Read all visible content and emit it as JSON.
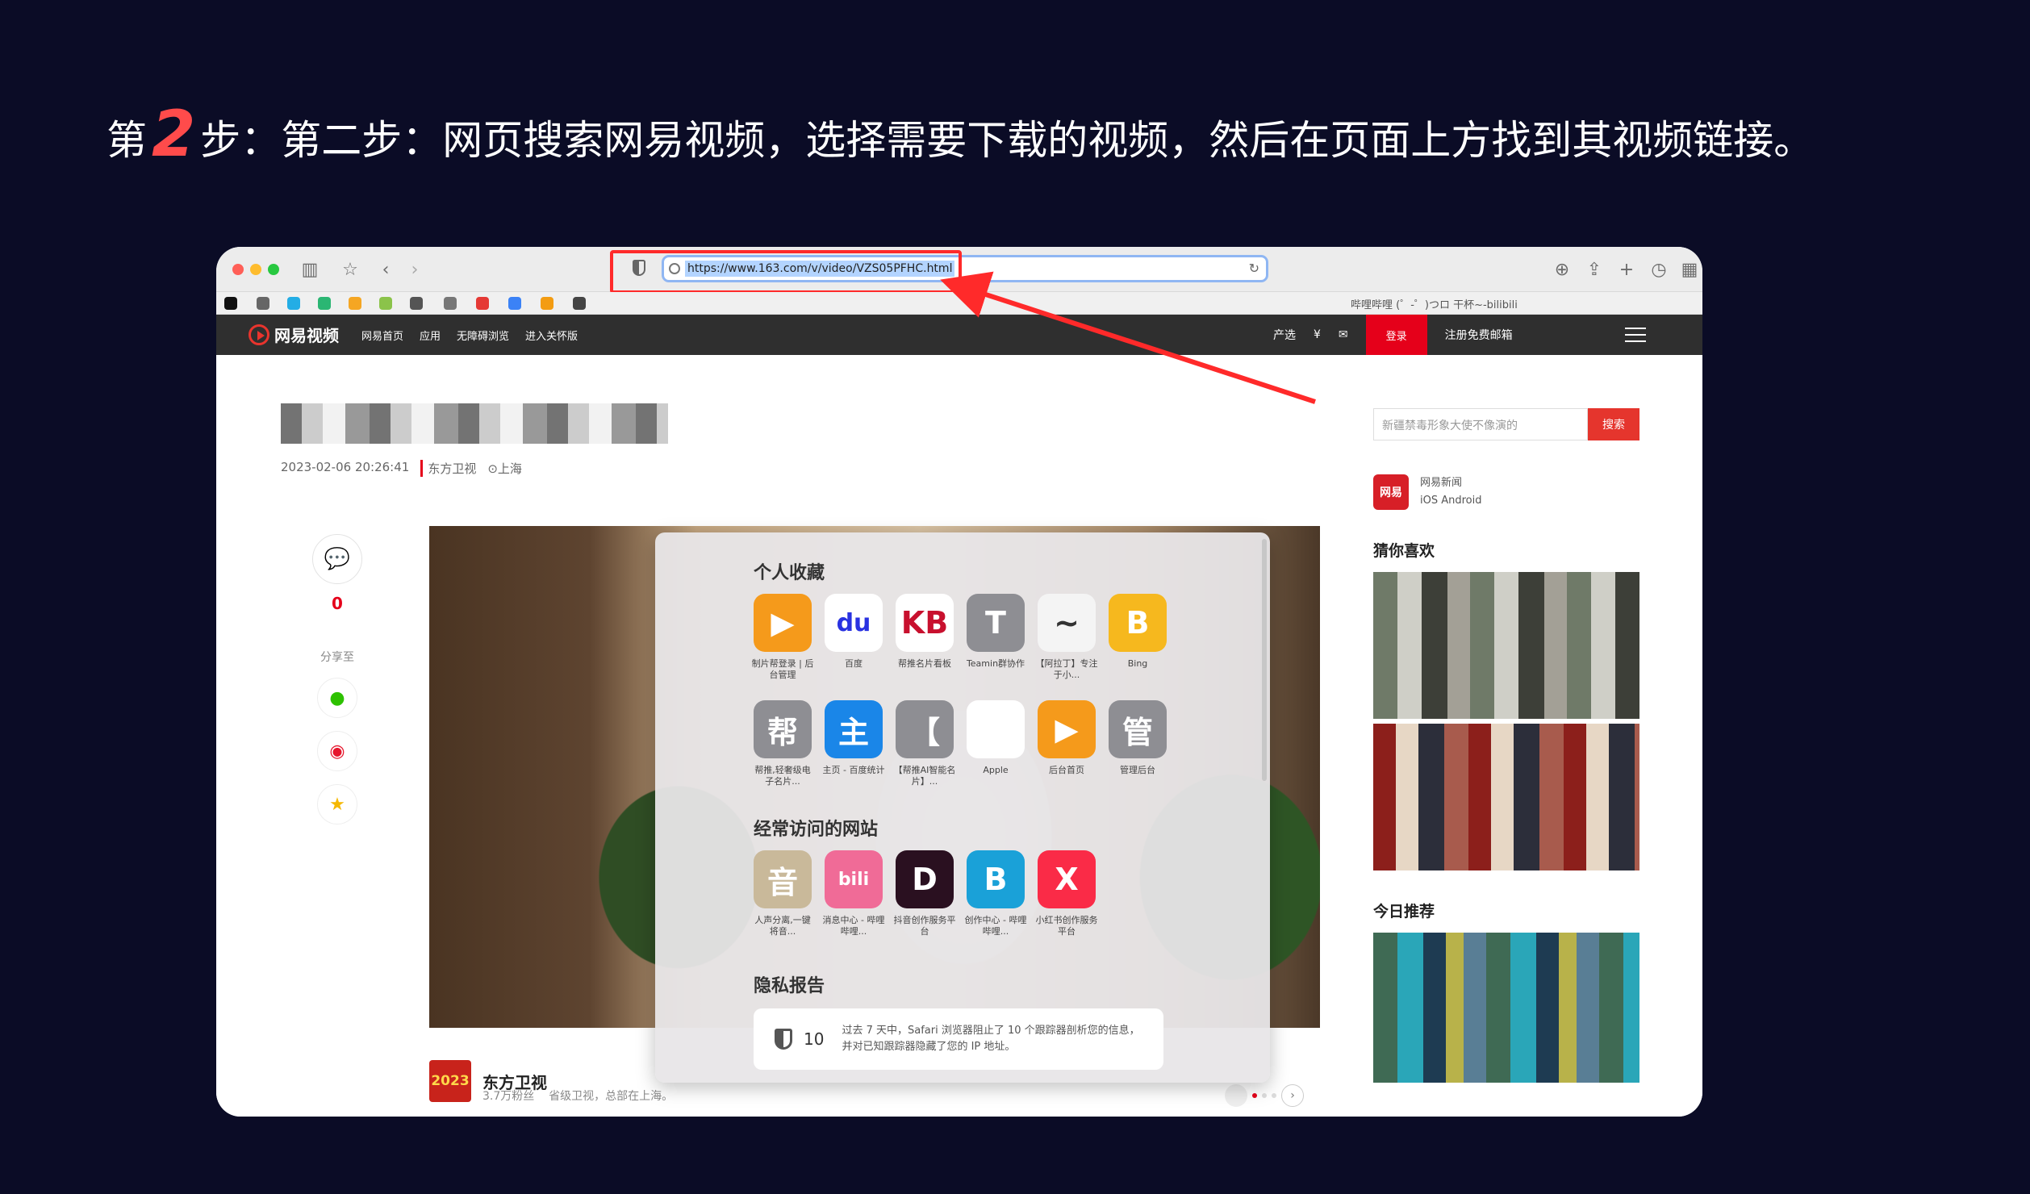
{
  "heading": {
    "prefix": "第",
    "number": "2",
    "text": "步：第二步：网页搜索网易视频，选择需要下载的视频，然后在页面上方找到其视频链接。"
  },
  "browser": {
    "url": "https://www.163.com/v/video/VZS05PFHC.html",
    "tab_title": "哔哩哔哩 (゜-゜)つロ 干杯~-bilibili",
    "icons": [
      "sidebar-icon",
      "bookmark-star-icon",
      "back-icon",
      "forward-icon",
      "shield-icon",
      "reload-icon",
      "download-icon",
      "share-icon",
      "new-tab-icon",
      "history-icon",
      "tab-overview-icon"
    ]
  },
  "site_nav": {
    "logo": "网易视频",
    "links": [
      "网易首页",
      "应用",
      "无障碍浏览",
      "进入关怀版"
    ],
    "right": [
      "产选",
      "¥",
      "✉"
    ],
    "login": "登录",
    "register": "注册免费邮箱"
  },
  "article": {
    "date": "2023-02-06 20:26:41",
    "source": "东方卫视",
    "location": "上海",
    "comment_count": "0",
    "share_label": "分享至",
    "channel_name": "东方卫视",
    "channel_logo": "2023",
    "channel_fans": "3.7万粉丝",
    "channel_desc": "省级卫视，总部在上海。"
  },
  "sidebar": {
    "search_placeholder": "新疆禁毒形象大使不像演的",
    "search_button": "搜索",
    "app_logo": "网易",
    "app_name": "网易新闻",
    "app_platforms": "iOS Android",
    "guess_title": "猜你喜欢",
    "today_title": "今日推荐"
  },
  "safari_start": {
    "favorites_title": "个人收藏",
    "favorites": [
      {
        "glyph": "▶",
        "label": "制片帮登录 | 后台管理",
        "color": "#f59a1b"
      },
      {
        "glyph": "du",
        "label": "百度",
        "color": "#ffffff"
      },
      {
        "glyph": "KB",
        "label": "帮推名片看板",
        "color": "#ffffff"
      },
      {
        "glyph": "T",
        "label": "Teamin群协作",
        "color": "#8e8e93"
      },
      {
        "glyph": "~",
        "label": "【阿拉丁】专注于小...",
        "color": "#f4f4f4"
      },
      {
        "glyph": "B",
        "label": "Bing",
        "color": "#f6b81e"
      },
      {
        "glyph": "帮",
        "label": "帮推,轻奢级电子名片...",
        "color": "#8e8e93"
      },
      {
        "glyph": "主",
        "label": "主页 - 百度统计",
        "color": "#1a86e8"
      },
      {
        "glyph": "【",
        "label": "【帮推AI智能名片】...",
        "color": "#8e8e93"
      },
      {
        "glyph": "",
        "label": "Apple",
        "color": "#ffffff"
      },
      {
        "glyph": "▶",
        "label": "后台首页",
        "color": "#f59a1b"
      },
      {
        "glyph": "管",
        "label": "管理后台",
        "color": "#8e8e93"
      }
    ],
    "frequent_title": "经常访问的网站",
    "frequent": [
      {
        "glyph": "音",
        "label": "人声分离,一键将音...",
        "color": "#c9b99a"
      },
      {
        "glyph": "bili",
        "label": "消息中心 - 哔哩哔哩...",
        "color": "#f06b97"
      },
      {
        "glyph": "D",
        "label": "抖音创作服务平台",
        "color": "#2a1020"
      },
      {
        "glyph": "B",
        "label": "创作中心 - 哔哩哔哩...",
        "color": "#1aa1d8"
      },
      {
        "glyph": "X",
        "label": "小红书创作服务平台",
        "color": "#fa2b47"
      }
    ],
    "privacy_title": "隐私报告",
    "privacy_count": "10",
    "privacy_text": "过去 7 天中，Safari 浏览器阻止了 10 个跟踪器剖析您的信息，并对已知跟踪器隐藏了您的 IP 地址。"
  },
  "colors": {
    "background": "#0b0c26",
    "accent": "#ff4b4b",
    "netease_red": "#e5001a"
  }
}
